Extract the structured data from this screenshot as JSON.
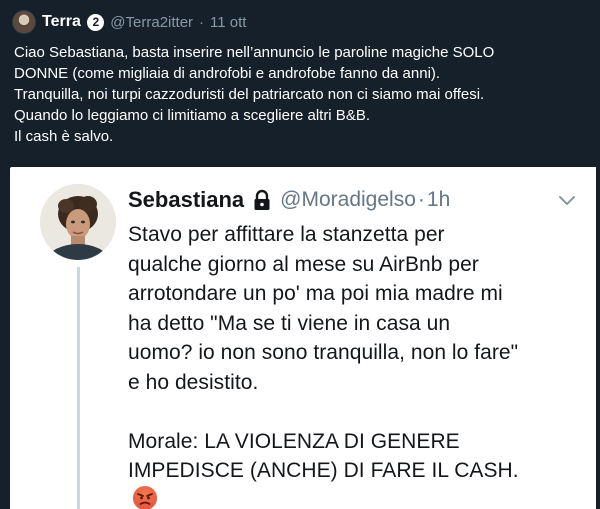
{
  "outer_tweet": {
    "display_name": "Terra",
    "name_badge": "2",
    "handle": "@Terra2itter",
    "separator": "·",
    "timestamp": "11 ott",
    "text_lines": [
      "Ciao Sebastiana, basta inserire nell’annuncio le paroline magiche SOLO",
      "DONNE (come migliaia di androfobi e androfobe fanno da anni).",
      "Tranquilla, noi turpi cazzoduristi del patriarcato non ci siamo mai offesi.",
      "Quando lo leggiamo ci limitiamo a scegliere altri B&B.",
      "Il cash è salvo."
    ]
  },
  "quoted_tweet": {
    "display_name": "Sebastiana",
    "handle": "@Moradigelso",
    "separator": "·",
    "timestamp": "1h",
    "text_lines": [
      "Stavo per affittare la stanzetta per",
      "qualche giorno al mese su AirBnb per",
      "arrotondare un po' ma poi mia madre mi",
      "ha detto \"Ma se ti viene in casa un",
      "uomo? io non sono tranquilla, non lo fare\"",
      "e ho desistito."
    ],
    "text_lines_2": [
      "Morale: LA VIOLENZA DI GENERE",
      "IMPEDISCE (ANCHE) DI FARE IL CASH."
    ],
    "emoji": "angry-face-emoji"
  },
  "colors": {
    "dark_bg": "#15202b",
    "muted_text": "#8899a6",
    "quoted_bg": "#ffffff",
    "quoted_text": "#14171a",
    "quoted_muted": "#657786"
  }
}
